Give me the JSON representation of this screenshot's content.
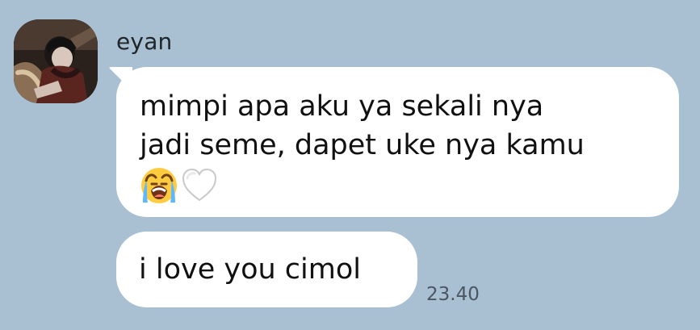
{
  "conversation": {
    "sender": {
      "name": "eyan"
    },
    "messages": [
      {
        "lines": [
          "mimpi apa aku ya sekali nya",
          "jadi seme, dapet uke nya kamu"
        ],
        "emojis": [
          "loudly-crying-face-icon",
          "white-heart-icon"
        ]
      },
      {
        "text": "i love you cimol",
        "time": "23.40"
      }
    ]
  },
  "colors": {
    "background": "#a9bfd2",
    "bubble": "#ffffff",
    "timestamp": "#4a5661"
  }
}
